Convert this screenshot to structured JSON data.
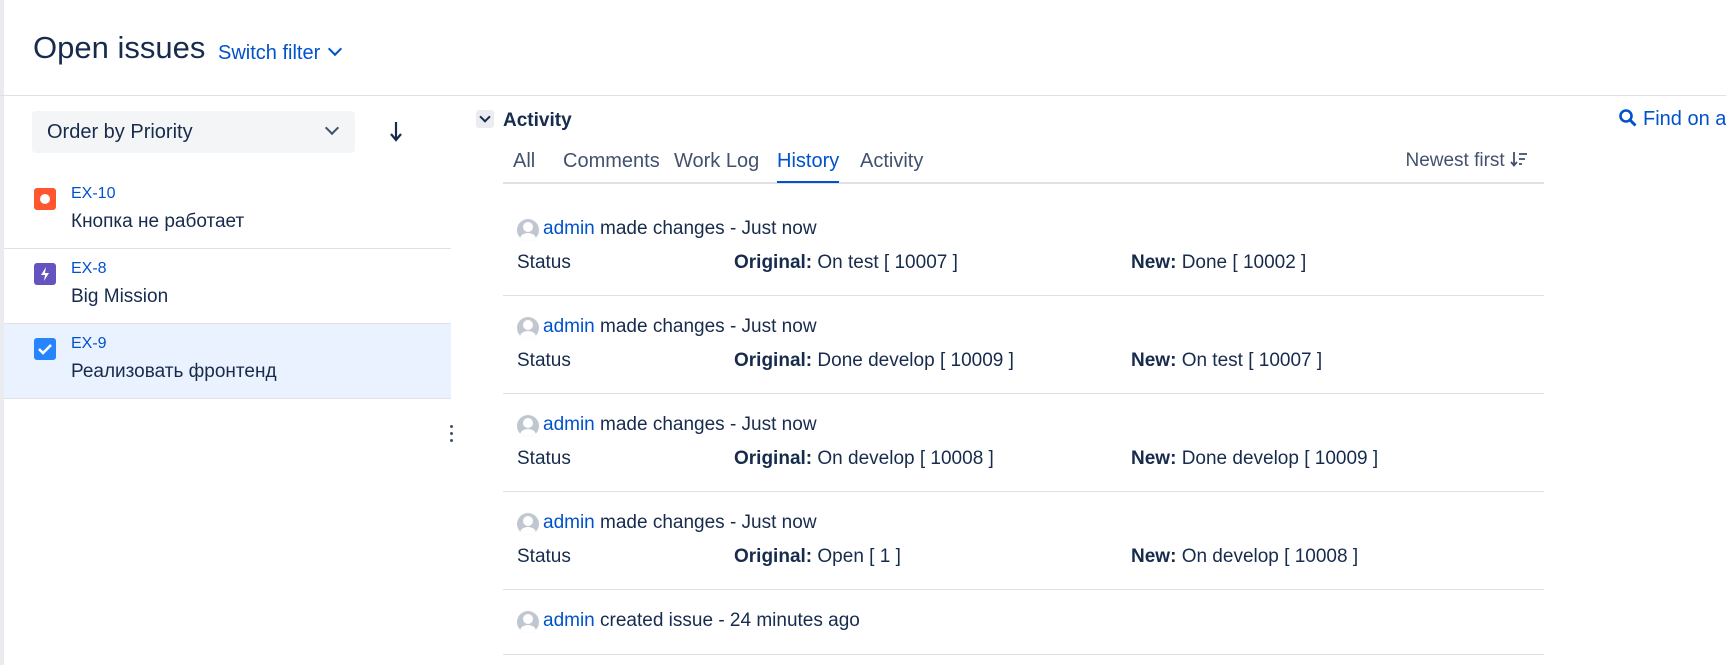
{
  "header": {
    "title": "Open issues",
    "switch_filter_label": "Switch filter"
  },
  "sidebar": {
    "order_by_label": "Order by Priority",
    "issues": [
      {
        "key": "EX-10",
        "summary": "Кнопка не работает",
        "type": "bug",
        "icon_color": "#ff5630",
        "selected": false
      },
      {
        "key": "EX-8",
        "summary": "Big Mission",
        "type": "epic",
        "icon_color": "#6554c0",
        "selected": false
      },
      {
        "key": "EX-9",
        "summary": "Реализовать фронтенд",
        "type": "task",
        "icon_color": "#2684ff",
        "selected": true
      }
    ]
  },
  "activity": {
    "title": "Activity",
    "find_label": "Find on a",
    "tabs": [
      {
        "label": "All",
        "active": false
      },
      {
        "label": "Comments",
        "active": false
      },
      {
        "label": "Work Log",
        "active": false
      },
      {
        "label": "History",
        "active": true
      },
      {
        "label": "Activity",
        "active": false
      }
    ],
    "sort_label": "Newest first",
    "sort_icon": "sort-descending-icon",
    "entries": [
      {
        "user": "admin",
        "action": "made changes - Just now",
        "field": "Status",
        "original_label": "Original:",
        "original_value": "On test [ 10007 ]",
        "new_label": "New:",
        "new_value": "Done [ 10002 ]"
      },
      {
        "user": "admin",
        "action": "made changes - Just now",
        "field": "Status",
        "original_label": "Original:",
        "original_value": "Done develop [ 10009 ]",
        "new_label": "New:",
        "new_value": "On test [ 10007 ]"
      },
      {
        "user": "admin",
        "action": "made changes - Just now",
        "field": "Status",
        "original_label": "Original:",
        "original_value": "On develop [ 10008 ]",
        "new_label": "New:",
        "new_value": "Done develop [ 10009 ]"
      },
      {
        "user": "admin",
        "action": "made changes - Just now",
        "field": "Status",
        "original_label": "Original:",
        "original_value": "Open [ 1 ]",
        "new_label": "New:",
        "new_value": "On develop [ 10008 ]"
      },
      {
        "user": "admin",
        "action": "created issue - 24 minutes ago"
      }
    ]
  },
  "colors": {
    "link": "#0052cc",
    "text": "#172b4d",
    "selected_row": "#e9f2fe"
  }
}
